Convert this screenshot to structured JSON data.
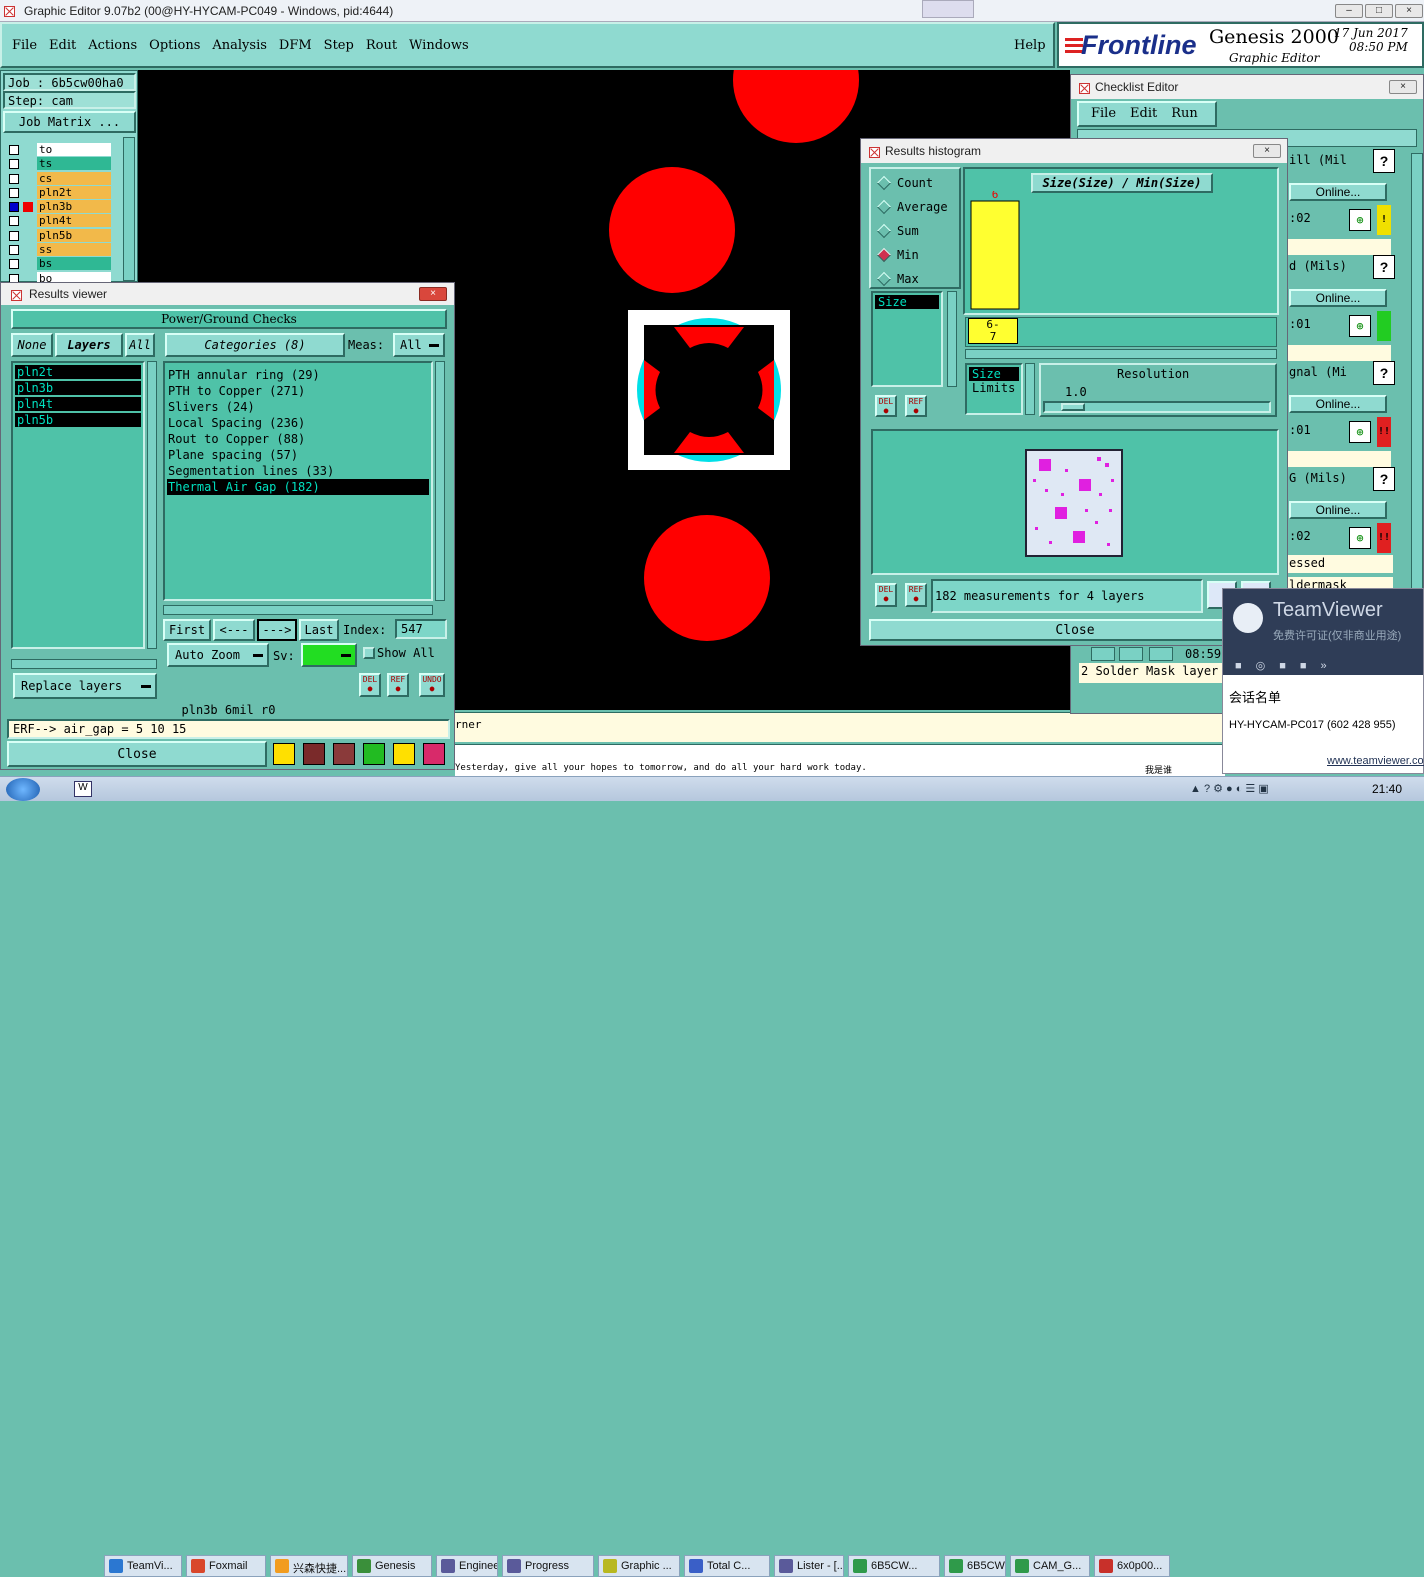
{
  "os_title": "Graphic Editor 9.07b2 (00@HY-HYCAM-PC049 - Windows, pid:4644)",
  "menu": [
    "File",
    "Edit",
    "Actions",
    "Options",
    "Analysis",
    "DFM",
    "Step",
    "Rout",
    "Windows"
  ],
  "help": "Help",
  "brand": {
    "logo": "Frontline",
    "product": "Genesis 2000",
    "subtitle": "Graphic Editor",
    "date": "17 Jun 2017",
    "time": "08:50 PM"
  },
  "job": {
    "job_label": "Job : 6b5cw00ha0",
    "step_label": "Step: cam",
    "matrix_btn": "Job Matrix ..."
  },
  "layers": [
    {
      "name": "to",
      "color": "#ffffff"
    },
    {
      "name": "ts",
      "color": "#2fb894"
    },
    {
      "name": "cs",
      "color": "#f2b94a"
    },
    {
      "name": "pln2t",
      "color": "#f2b94a"
    },
    {
      "name": "pln3b",
      "color": "#f2b94a"
    },
    {
      "name": "pln4t",
      "color": "#f2b94a"
    },
    {
      "name": "pln5b",
      "color": "#f2b94a"
    },
    {
      "name": "ss",
      "color": "#f2b94a"
    },
    {
      "name": "bs",
      "color": "#2fb894"
    },
    {
      "name": "bo",
      "color": "#ffffff"
    }
  ],
  "results_viewer": {
    "title": "Results viewer",
    "header": "Power/Ground Checks",
    "none_btn": "None",
    "layers_btn": "Layers",
    "all_btn": "All",
    "categories_btn": "Categories (8)",
    "meas_label": "Meas:",
    "meas_value": "All",
    "layer_list": [
      "pln2t",
      "pln3b",
      "pln4t",
      "pln5b"
    ],
    "categories": [
      "PTH annular ring (29)",
      "PTH to Copper (271)",
      "Slivers (24)",
      "Local Spacing (236)",
      "Rout to Copper (88)",
      "Plane spacing (57)",
      "Segmentation lines (33)",
      "Thermal Air Gap (182)"
    ],
    "first": "First",
    "prev": "<---",
    "next": "--->",
    "last": "Last",
    "index_label": "Index:",
    "index_value": "547",
    "zoom": "Auto Zoom",
    "sv_label": "Sv:",
    "show_all": "Show All",
    "replace": "Replace layers",
    "status": "pln3b   6mil   r0",
    "erf": "ERF--> air_gap = 5 10 15",
    "close": "Close"
  },
  "histogram": {
    "title": "Results histogram",
    "options": [
      "Count",
      "Average",
      "Sum",
      "Min",
      "Max"
    ],
    "selected": "Min",
    "chart_title": "Size(Size) / Min(Size)",
    "size_item": "Size",
    "bar_value": "6",
    "bin_label": "6-\n7",
    "limits_items": [
      "Size",
      "Limits"
    ],
    "resolution_label": "Resolution",
    "resolution_value": "1.0",
    "measurements": "182 measurements for 4 layers",
    "close": "Close"
  },
  "checklist": {
    "title": "Checklist Editor",
    "menu": [
      "File",
      "Edit",
      "Run"
    ],
    "rows": [
      {
        "label": "ill (Mil",
        "online": "Online...",
        "time": ":02",
        "flag_color": "#f0e000",
        "flag": "!"
      },
      {
        "label": "d (Mils)",
        "online": "Online...",
        "time": ":01",
        "flag_color": "#22cc22",
        "flag": ""
      },
      {
        "label": "gnal (Mi",
        "online": "Online...",
        "time": ":01",
        "flag_color": "#e02020",
        "flag": "!!"
      },
      {
        "label": "G (Mils)",
        "online": "Online...",
        "time": ":02",
        "flag_color": "#e02020",
        "flag": "!!"
      }
    ],
    "bottom1": "essed",
    "bottom2": "ldermask",
    "time_row": "08:59",
    "last_item": "2 Solder Mask layer"
  },
  "teamviewer": {
    "title": "TeamViewer",
    "subtitle": "免费许可证(仅非商业用途)",
    "session": "会话名单",
    "partner": "HY-HYCAM-PC017 (602 428 955)",
    "url": "www.teamviewer.com"
  },
  "hint": "rner",
  "marquee": "Yesterday, give all your hopes to tomorrow, and do all your hard work today.",
  "marquee_right": "我是谁",
  "taskbar": {
    "items": [
      {
        "label": "TeamVi...",
        "color": "#2b77d1"
      },
      {
        "label": "Foxmail",
        "color": "#d9472b"
      },
      {
        "label": "兴森快捷...",
        "color": "#f29c1f"
      },
      {
        "label": "Genesis",
        "color": "#3a8f3a"
      },
      {
        "label": "Enginee...",
        "color": "#5a5a9a"
      },
      {
        "label": "Progress",
        "color": "#5a5a9a"
      },
      {
        "label": "Graphic ...",
        "color": "#b8b820"
      },
      {
        "label": "Total C...",
        "color": "#3a5fc7"
      },
      {
        "label": "Lister - [...",
        "color": "#5a5a9a"
      },
      {
        "label": "6B5CW...",
        "color": "#2f9a4a"
      },
      {
        "label": "6B5CW...",
        "color": "#2f9a4a"
      },
      {
        "label": "CAM_G...",
        "color": "#2f9a4a"
      },
      {
        "label": "6x0p00...",
        "color": "#c8302a"
      }
    ],
    "clock": "21:40"
  }
}
